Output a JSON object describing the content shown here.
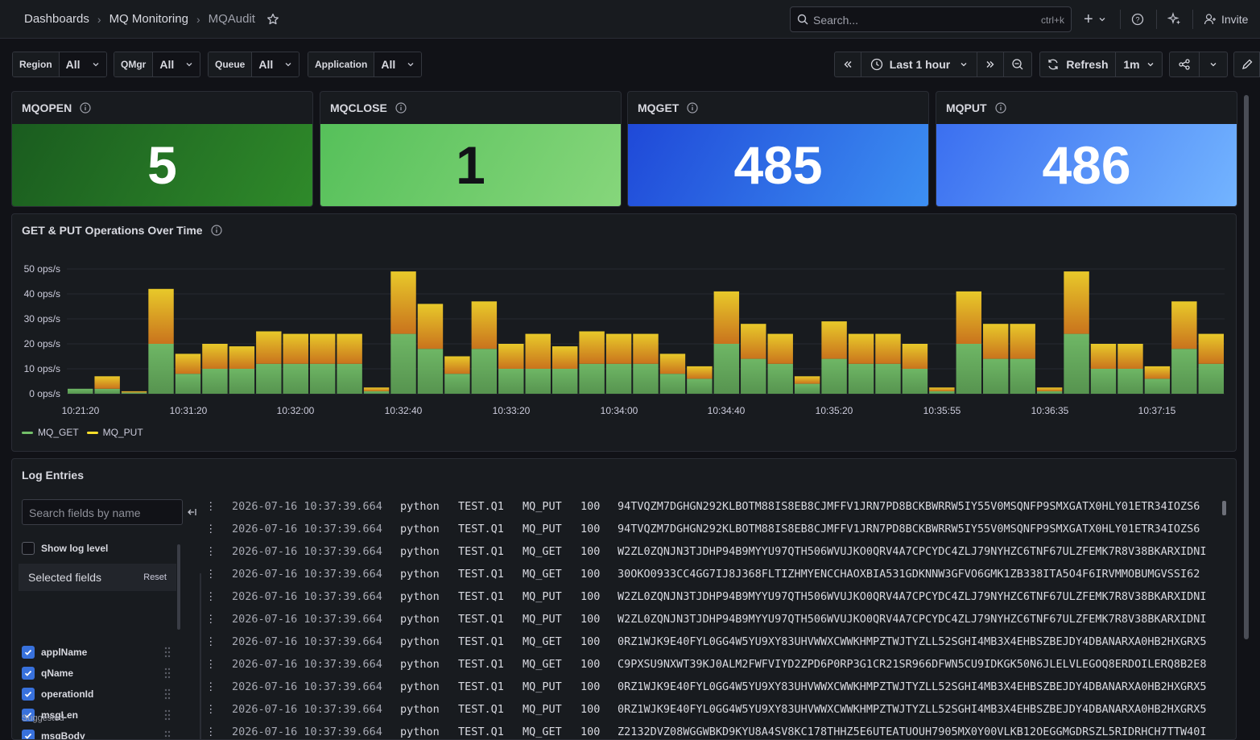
{
  "breadcrumb": {
    "items": [
      "Dashboards",
      "MQ Monitoring",
      "MQAudit"
    ]
  },
  "search": {
    "placeholder": "Search...",
    "shortcut": "ctrl+k"
  },
  "header_actions": {
    "add": "+",
    "invite": "Invite"
  },
  "variables": [
    {
      "label": "Region",
      "value": "All"
    },
    {
      "label": "QMgr",
      "value": "All"
    },
    {
      "label": "Queue",
      "value": "All"
    },
    {
      "label": "Application",
      "value": "All"
    }
  ],
  "time_controls": {
    "range": "Last 1 hour",
    "refresh_label": "Refresh",
    "refresh_interval": "1m"
  },
  "stats": [
    {
      "title": "MQOPEN",
      "value": "5",
      "colors": [
        "#1a5c1f",
        "#2f8a2a"
      ],
      "text_color": "#ffffff"
    },
    {
      "title": "MQCLOSE",
      "value": "1",
      "colors": [
        "#56c05a",
        "#86d67b"
      ],
      "text_color": "#111217"
    },
    {
      "title": "MQGET",
      "value": "485",
      "colors": [
        "#1f49d8",
        "#3d8ff2"
      ],
      "text_color": "#ffffff"
    },
    {
      "title": "MQPUT",
      "value": "486",
      "colors": [
        "#3b6ff0",
        "#73b4ff"
      ],
      "text_color": "#ffffff"
    }
  ],
  "timeseries": {
    "title": "GET & PUT Operations Over Time"
  },
  "chart_data": {
    "type": "bar",
    "stacked": true,
    "x_tick_labels": [
      "10:21:20",
      "10:31:20",
      "10:32:00",
      "10:32:40",
      "10:33:20",
      "10:34:00",
      "10:34:40",
      "10:35:20",
      "10:35:55",
      "10:36:35",
      "10:37:15"
    ],
    "y_tick_labels": [
      "0 ops/s",
      "10 ops/s",
      "20 ops/s",
      "30 ops/s",
      "40 ops/s",
      "50 ops/s"
    ],
    "ylim": [
      0,
      50
    ],
    "grid": true,
    "legend_position": "bottom-left",
    "series": [
      {
        "name": "MQ_GET",
        "color": "#73bf69",
        "values": [
          2,
          2,
          0.5,
          20,
          8,
          10,
          10,
          12,
          12,
          12,
          12,
          1,
          24,
          18,
          8,
          18,
          10,
          10,
          10,
          12,
          12,
          12,
          8,
          6,
          20,
          14,
          12,
          4,
          14,
          12,
          12,
          10,
          1,
          20,
          14,
          14,
          1,
          24,
          10,
          10,
          6,
          18,
          12
        ]
      },
      {
        "name": "MQ_PUT",
        "color": "#fade2a",
        "values": [
          0,
          5,
          0.5,
          22,
          8,
          10,
          9,
          13,
          12,
          12,
          12,
          1.5,
          25,
          18,
          7,
          19,
          10,
          14,
          9,
          13,
          12,
          12,
          8,
          5,
          21,
          14,
          12,
          3,
          15,
          12,
          12,
          10,
          1.5,
          21,
          14,
          14,
          1.5,
          25,
          10,
          10,
          5,
          19,
          12
        ]
      }
    ]
  },
  "logs": {
    "title": "Log Entries",
    "search_placeholder": "Search fields by name",
    "show_log_level": "Show log level",
    "selected_fields_title": "Selected fields",
    "reset_label": "Reset",
    "suggested_label": "Suggested",
    "selected_fields": [
      "applName",
      "qName",
      "operationId",
      "msgLen",
      "msgBody"
    ],
    "rows": [
      {
        "ts": "2026-07-16 10:37:39.664",
        "app": "python",
        "queue": "TEST.Q1",
        "op": "MQ_PUT",
        "len": "100",
        "body": "94TVQZM7DGHGN292KLBOTM88IS8EB8CJMFFV1JRN7PD8BCKBWRRW5IY55V0MSQNFP9SMXGATX0HLY01ETR34IOZS6"
      },
      {
        "ts": "2026-07-16 10:37:39.664",
        "app": "python",
        "queue": "TEST.Q1",
        "op": "MQ_PUT",
        "len": "100",
        "body": "94TVQZM7DGHGN292KLBOTM88IS8EB8CJMFFV1JRN7PD8BCKBWRRW5IY55V0MSQNFP9SMXGATX0HLY01ETR34IOZS6"
      },
      {
        "ts": "2026-07-16 10:37:39.664",
        "app": "python",
        "queue": "TEST.Q1",
        "op": "MQ_GET",
        "len": "100",
        "body": "W2ZL0ZQNJN3TJDHP94B9MYYU97QTH506WVUJKO0QRV4A7CPCYDC4ZLJ79NYHZC6TNF67ULZFEMK7R8V38BKARXIDNI"
      },
      {
        "ts": "2026-07-16 10:37:39.664",
        "app": "python",
        "queue": "TEST.Q1",
        "op": "MQ_GET",
        "len": "100",
        "body": "30OKO0933CC4GG7IJ8J368FLTIZHMYENCCHAOXBIA531GDKNNW3GFVO6GMK1ZB338ITA5O4F6IRVMMOBUMGVSSI62"
      },
      {
        "ts": "2026-07-16 10:37:39.664",
        "app": "python",
        "queue": "TEST.Q1",
        "op": "MQ_PUT",
        "len": "100",
        "body": "W2ZL0ZQNJN3TJDHP94B9MYYU97QTH506WVUJKO0QRV4A7CPCYDC4ZLJ79NYHZC6TNF67ULZFEMK7R8V38BKARXIDNI"
      },
      {
        "ts": "2026-07-16 10:37:39.664",
        "app": "python",
        "queue": "TEST.Q1",
        "op": "MQ_PUT",
        "len": "100",
        "body": "W2ZL0ZQNJN3TJDHP94B9MYYU97QTH506WVUJKO0QRV4A7CPCYDC4ZLJ79NYHZC6TNF67ULZFEMK7R8V38BKARXIDNI"
      },
      {
        "ts": "2026-07-16 10:37:39.664",
        "app": "python",
        "queue": "TEST.Q1",
        "op": "MQ_GET",
        "len": "100",
        "body": "0RZ1WJK9E40FYL0GG4W5YU9XY83UHVWWXCWWKHMPZTWJTYZLL52SGHI4MB3X4EHBSZBEJDY4DBANARXA0HB2HXGRX5"
      },
      {
        "ts": "2026-07-16 10:37:39.664",
        "app": "python",
        "queue": "TEST.Q1",
        "op": "MQ_GET",
        "len": "100",
        "body": "C9PXSU9NXWT39KJ0ALM2FWFVIYD2ZPD6P0RP3G1CR21SR966DFWN5CU9IDKGK50N6JLELVLEGOQ8ERDOILERQ8B2E8"
      },
      {
        "ts": "2026-07-16 10:37:39.664",
        "app": "python",
        "queue": "TEST.Q1",
        "op": "MQ_PUT",
        "len": "100",
        "body": "0RZ1WJK9E40FYL0GG4W5YU9XY83UHVWWXCWWKHMPZTWJTYZLL52SGHI4MB3X4EHBSZBEJDY4DBANARXA0HB2HXGRX5"
      },
      {
        "ts": "2026-07-16 10:37:39.664",
        "app": "python",
        "queue": "TEST.Q1",
        "op": "MQ_PUT",
        "len": "100",
        "body": "0RZ1WJK9E40FYL0GG4W5YU9XY83UHVWWXCWWKHMPZTWJTYZLL52SGHI4MB3X4EHBSZBEJDY4DBANARXA0HB2HXGRX5"
      },
      {
        "ts": "2026-07-16 10:37:39.664",
        "app": "python",
        "queue": "TEST.Q1",
        "op": "MQ_GET",
        "len": "100",
        "body": "Z2132DVZ08WGGWBKD9KYU8A4SV8KC178THHZ5E6UTEATUOUH7905MX0Y00VLKB12OEGGMGDRSZL5RIDRHCH7TTW40I"
      }
    ]
  }
}
